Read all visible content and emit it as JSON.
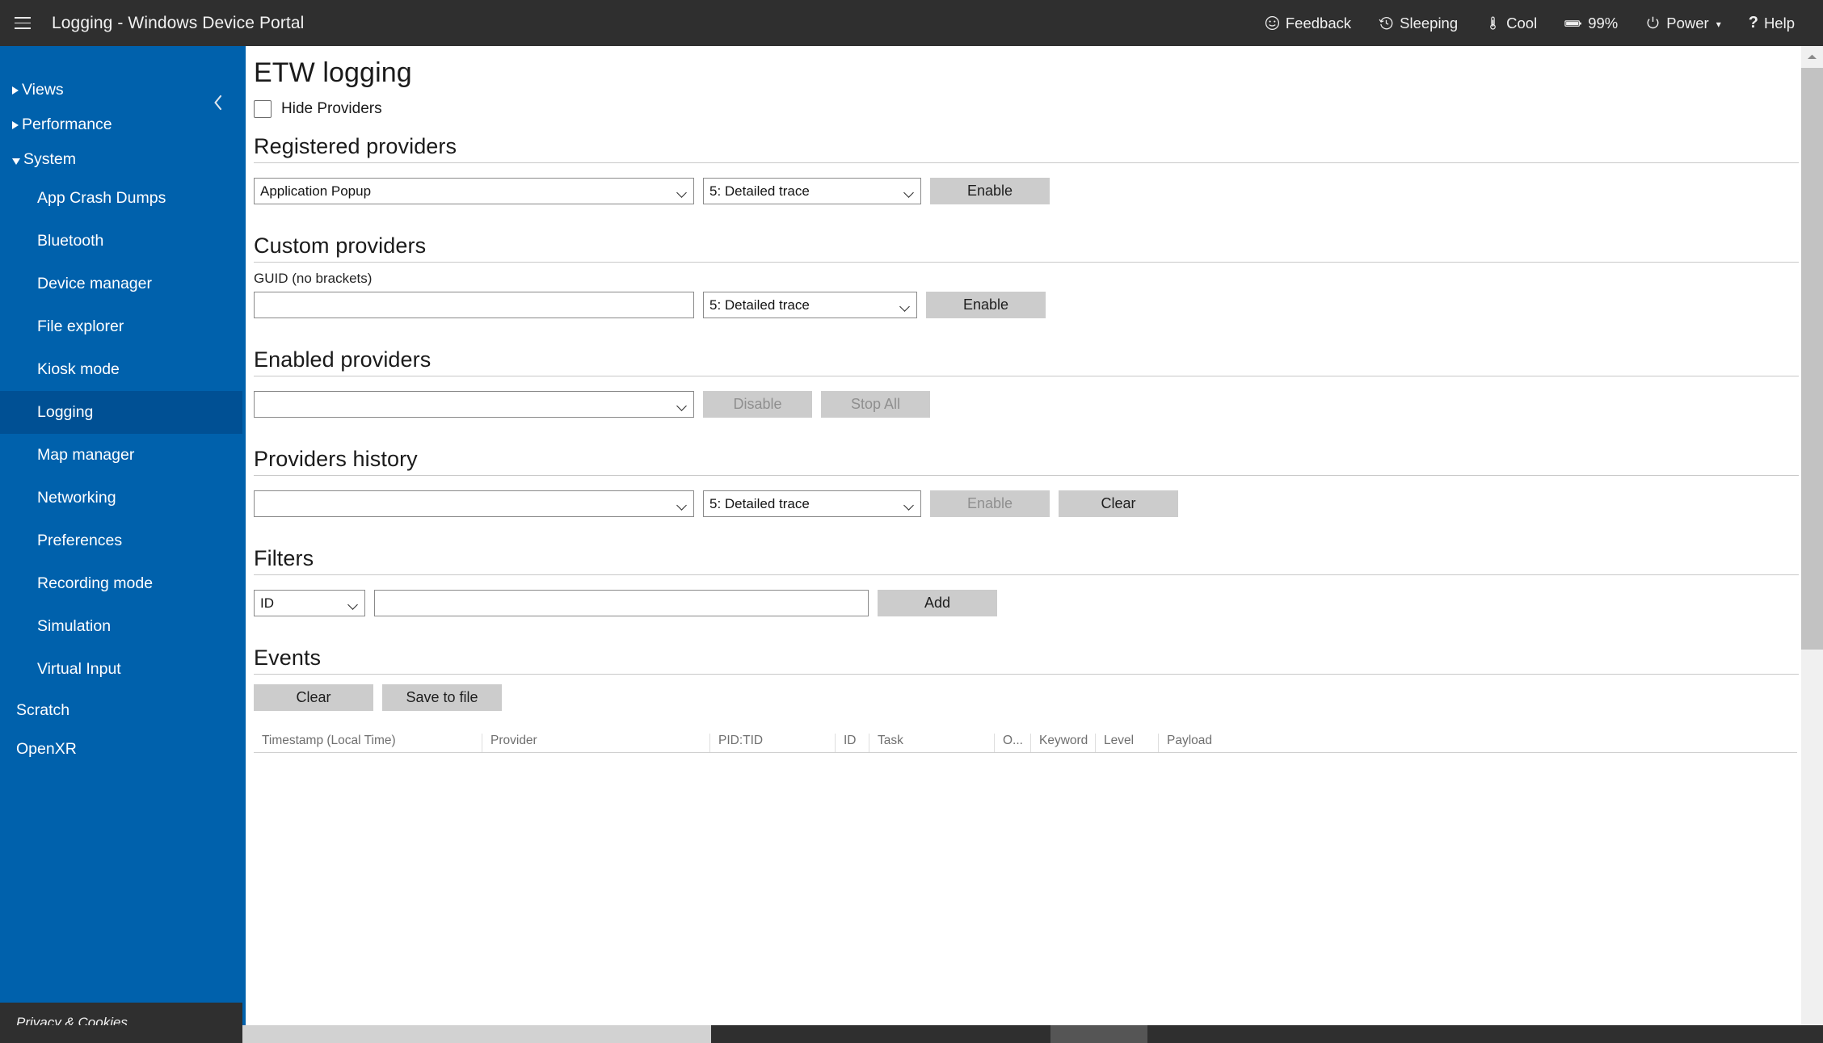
{
  "topbar": {
    "menu_icon": "hamburger-icon",
    "title": "Logging - Windows Device Portal",
    "items": [
      {
        "label": "Feedback",
        "icon": "smiley-icon"
      },
      {
        "label": "Sleeping",
        "icon": "history-clock-icon"
      },
      {
        "label": "Cool",
        "icon": "thermometer-icon"
      },
      {
        "label": "99%",
        "icon": "battery-icon"
      },
      {
        "label": "Power",
        "icon": "power-icon",
        "caret": "▾"
      },
      {
        "label": "Help",
        "icon": "question-mark-icon"
      }
    ]
  },
  "sidebar": {
    "collapse_icon": "chevron-left-icon",
    "groups": [
      {
        "label": "Views",
        "expanded": false
      },
      {
        "label": "Performance",
        "expanded": false
      },
      {
        "label": "System",
        "expanded": true
      }
    ],
    "system_items": [
      "App Crash Dumps",
      "Bluetooth",
      "Device manager",
      "File explorer",
      "Kiosk mode",
      "Logging",
      "Map manager",
      "Networking",
      "Preferences",
      "Recording mode",
      "Simulation",
      "Virtual Input"
    ],
    "selected_item": "Logging",
    "root_items": [
      "Scratch",
      "OpenXR"
    ],
    "footer": "Privacy & Cookies",
    "accent_color": "#0061ac",
    "selected_color": "#005094"
  },
  "main": {
    "page_title": "ETW logging",
    "hide_providers": {
      "label": "Hide Providers",
      "checked": false
    },
    "registered": {
      "heading": "Registered providers",
      "provider_value": "Application Popup",
      "level_value": "5: Detailed trace",
      "enable_label": "Enable",
      "enable_disabled": false
    },
    "custom": {
      "heading": "Custom providers",
      "guid_label": "GUID (no brackets)",
      "guid_value": "",
      "guid_placeholder": "",
      "level_value": "5: Detailed trace",
      "enable_label": "Enable",
      "enable_disabled": false
    },
    "enabled": {
      "heading": "Enabled providers",
      "provider_value": "",
      "disable_label": "Disable",
      "disable_disabled": true,
      "stop_all_label": "Stop All",
      "stop_all_disabled": true
    },
    "history": {
      "heading": "Providers history",
      "provider_value": "",
      "level_value": "5: Detailed trace",
      "enable_label": "Enable",
      "enable_disabled": true,
      "clear_label": "Clear",
      "clear_disabled": false
    },
    "filters": {
      "heading": "Filters",
      "type_value": "ID",
      "filter_value": "",
      "filter_placeholder": "",
      "add_label": "Add"
    },
    "events": {
      "heading": "Events",
      "clear_label": "Clear",
      "save_label": "Save to file",
      "columns": [
        "Timestamp (Local Time)",
        "Provider",
        "PID:TID",
        "ID",
        "Task",
        "O...",
        "Keyword",
        "Level",
        "Payload"
      ],
      "rows": []
    }
  },
  "scrollbars": {
    "vertical_arrow": "chevron-up-icon"
  }
}
